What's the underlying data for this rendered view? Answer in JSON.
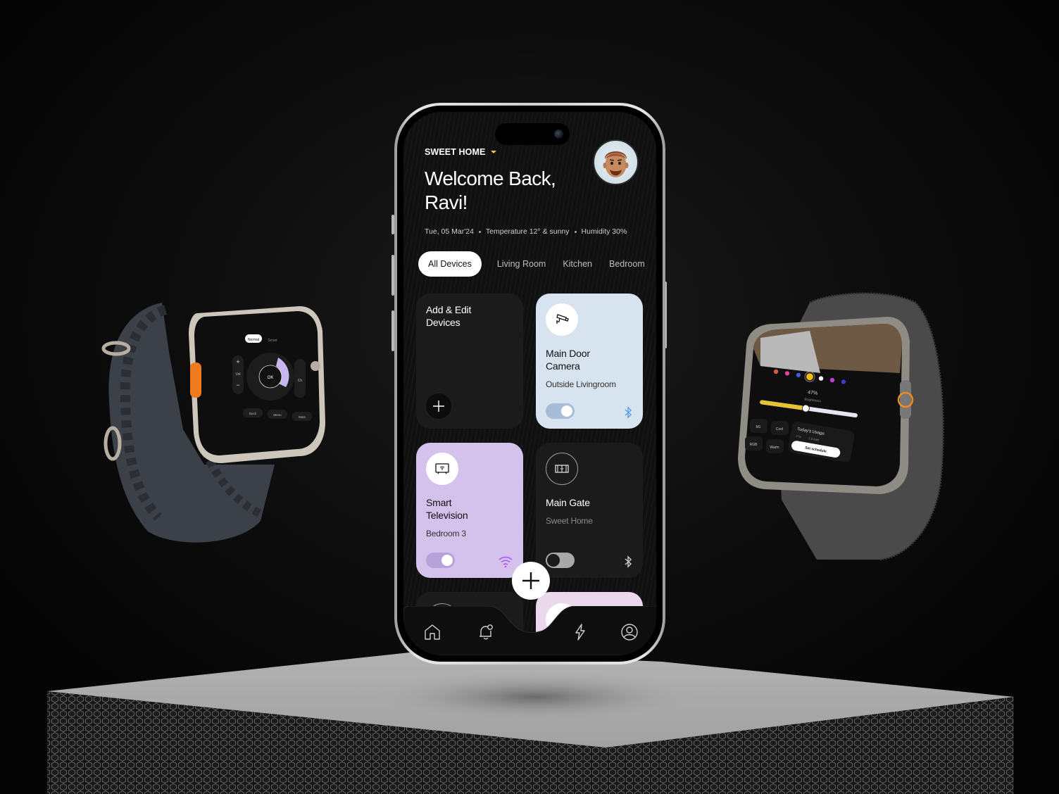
{
  "app": {
    "home_selector": "SWEET HOME",
    "welcome_line1": "Welcome Back,",
    "welcome_line2": "Ravi!",
    "date": "Tue, 05 Mar'24",
    "temperature": "Temperature 12° & sunny",
    "humidity": "Humidity 30%"
  },
  "tabs": [
    {
      "label": "All Devices",
      "active": true
    },
    {
      "label": "Living Room",
      "active": false
    },
    {
      "label": "Kitchen",
      "active": false
    },
    {
      "label": "Bedroom",
      "active": false
    }
  ],
  "cards": {
    "add": {
      "title_line1": "Add & Edit",
      "title_line2": "Devices"
    },
    "camera": {
      "title_line1": "Main Door",
      "title_line2": "Camera",
      "location": "Outside Livingroom",
      "on": true,
      "connection": "bluetooth",
      "icon": "cctv-camera-icon"
    },
    "tv": {
      "title_line1": "Smart",
      "title_line2": "Television",
      "location": "Bedroom 3",
      "on": true,
      "connection": "wifi",
      "icon": "smart-tv-icon"
    },
    "gate": {
      "title_line1": "Main Gate",
      "location": "Sweet Home",
      "on": false,
      "connection": "bluetooth",
      "icon": "gate-icon"
    }
  },
  "nav": [
    "home-icon",
    "notification-bell-icon",
    "add-icon",
    "energy-bolt-icon",
    "profile-icon"
  ],
  "colors": {
    "accent_yellow": "#e9c84a",
    "camera_card": "#d8e3f0",
    "tv_card": "#d4c2ec",
    "dark_card": "#1b1b1b",
    "bluetooth_blue": "#5b9cf0",
    "wifi_purple": "#a855f7"
  },
  "watch_left": {
    "modes": [
      "Normal",
      "Smart"
    ],
    "active_mode": "Normal",
    "vol_label": "Vol",
    "ch_label": "Ch",
    "ok_label": "OK",
    "buttons": [
      "Back",
      "Menu",
      "Mute"
    ]
  },
  "watch_right": {
    "brightness": "47%",
    "brightness_label": "Brightness",
    "brightness_value": 0.47,
    "presets": [
      "M1",
      "Cool",
      "RGB",
      "Warm"
    ],
    "usage_title": "Today's Usage",
    "usage_time": "2 hr",
    "usage_energy": "1.5 kwh",
    "schedule_button": "Set schedule",
    "color_swatches": [
      "#e05a3a",
      "#e0438f",
      "#3b5bdb",
      "#f5b800",
      "#ffffff",
      "#c13fd6",
      "#4338ca"
    ]
  }
}
